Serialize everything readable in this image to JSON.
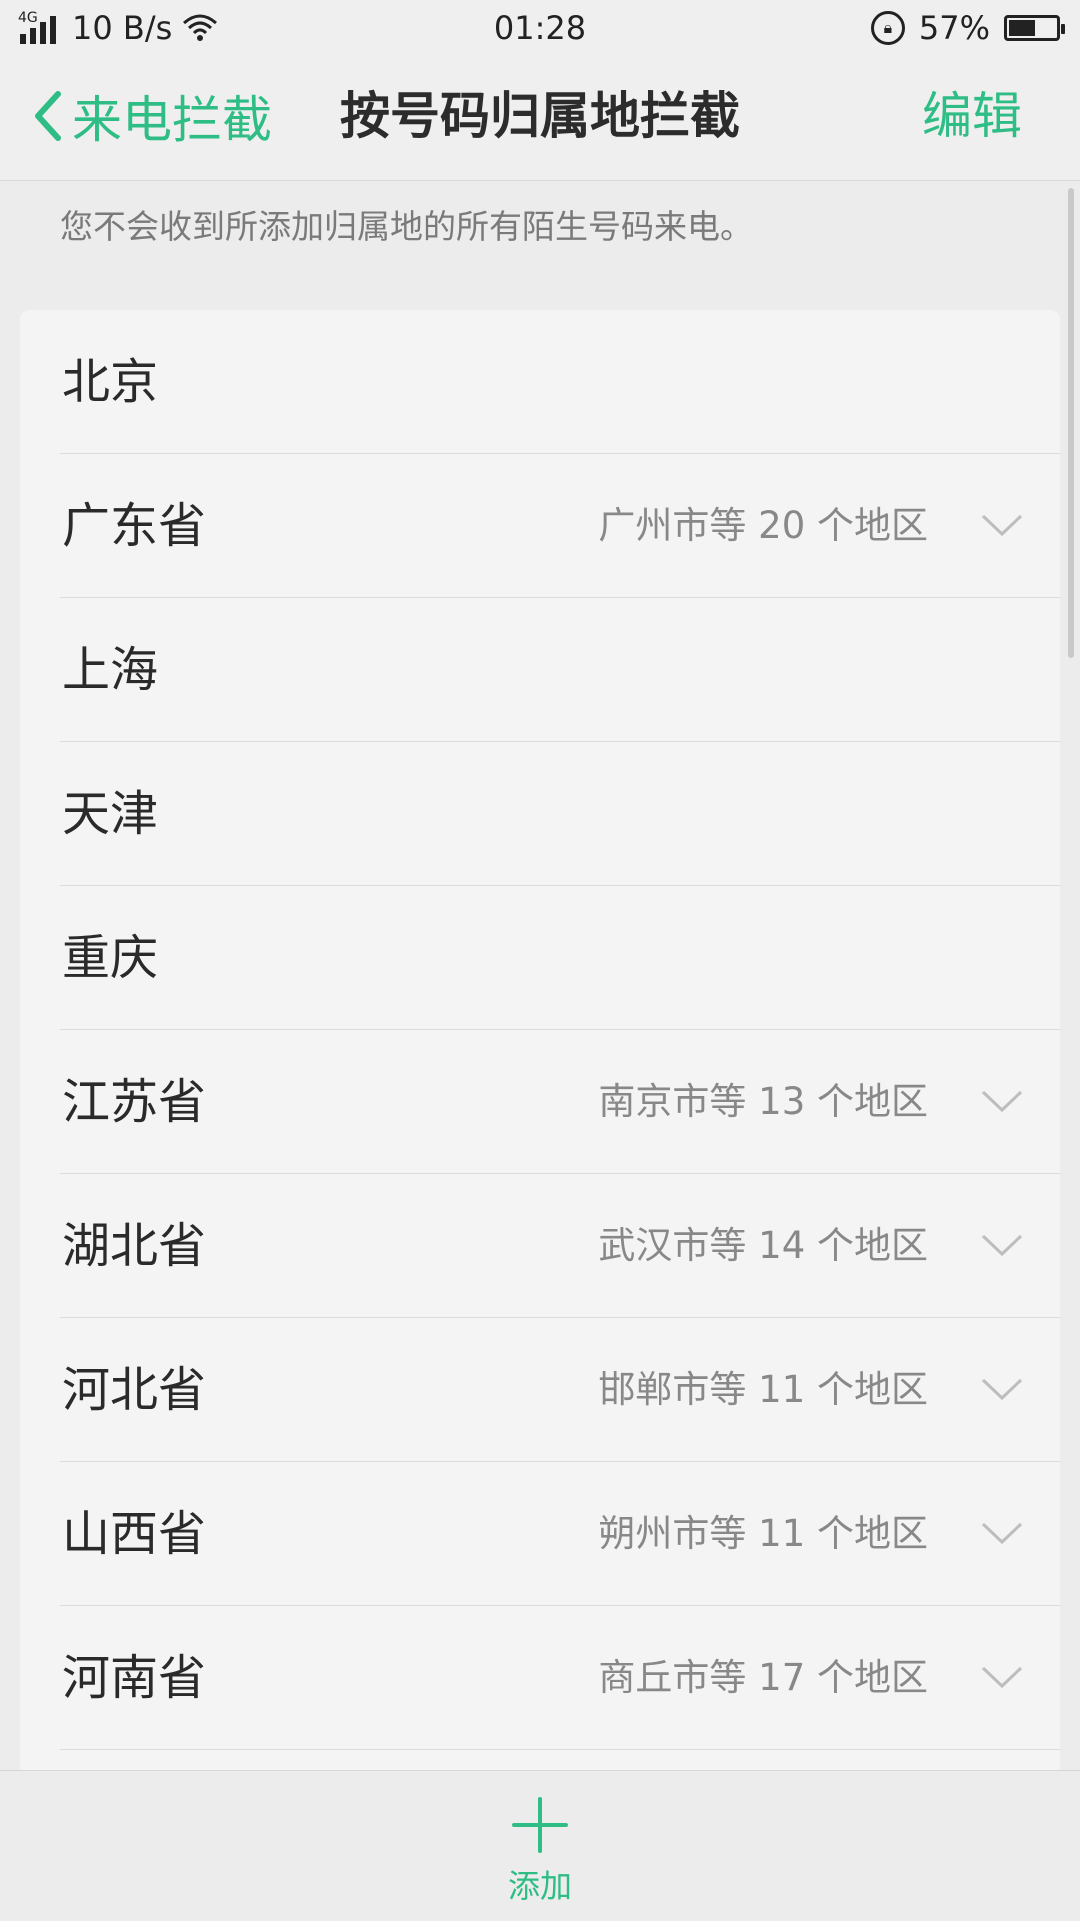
{
  "status_bar": {
    "network_type": "4G",
    "speed": "10 B/s",
    "time": "01:28",
    "battery_percent": "57%",
    "battery_level": 0.57,
    "icons": [
      "signal-icon",
      "wifi-icon",
      "rotation-lock-icon",
      "battery-icon"
    ]
  },
  "nav": {
    "back_label": "来电拦截",
    "title": "按号码归属地拦截",
    "edit_label": "编辑"
  },
  "description": "您不会收到所添加归属地的所有陌生号码来电。",
  "regions": [
    {
      "name": "北京",
      "sub": ""
    },
    {
      "name": "广东省",
      "sub": "广州市等 20 个地区"
    },
    {
      "name": "上海",
      "sub": ""
    },
    {
      "name": "天津",
      "sub": ""
    },
    {
      "name": "重庆",
      "sub": ""
    },
    {
      "name": "江苏省",
      "sub": "南京市等 13 个地区"
    },
    {
      "name": "湖北省",
      "sub": "武汉市等 14 个地区"
    },
    {
      "name": "河北省",
      "sub": "邯郸市等 11 个地区"
    },
    {
      "name": "山西省",
      "sub": "朔州市等 11 个地区"
    },
    {
      "name": "河南省",
      "sub": "商丘市等 17 个地区"
    }
  ],
  "bottom": {
    "add_label": "添加"
  },
  "colors": {
    "accent": "#2ebd85",
    "background": "#ececec",
    "card": "#f4f4f4"
  }
}
